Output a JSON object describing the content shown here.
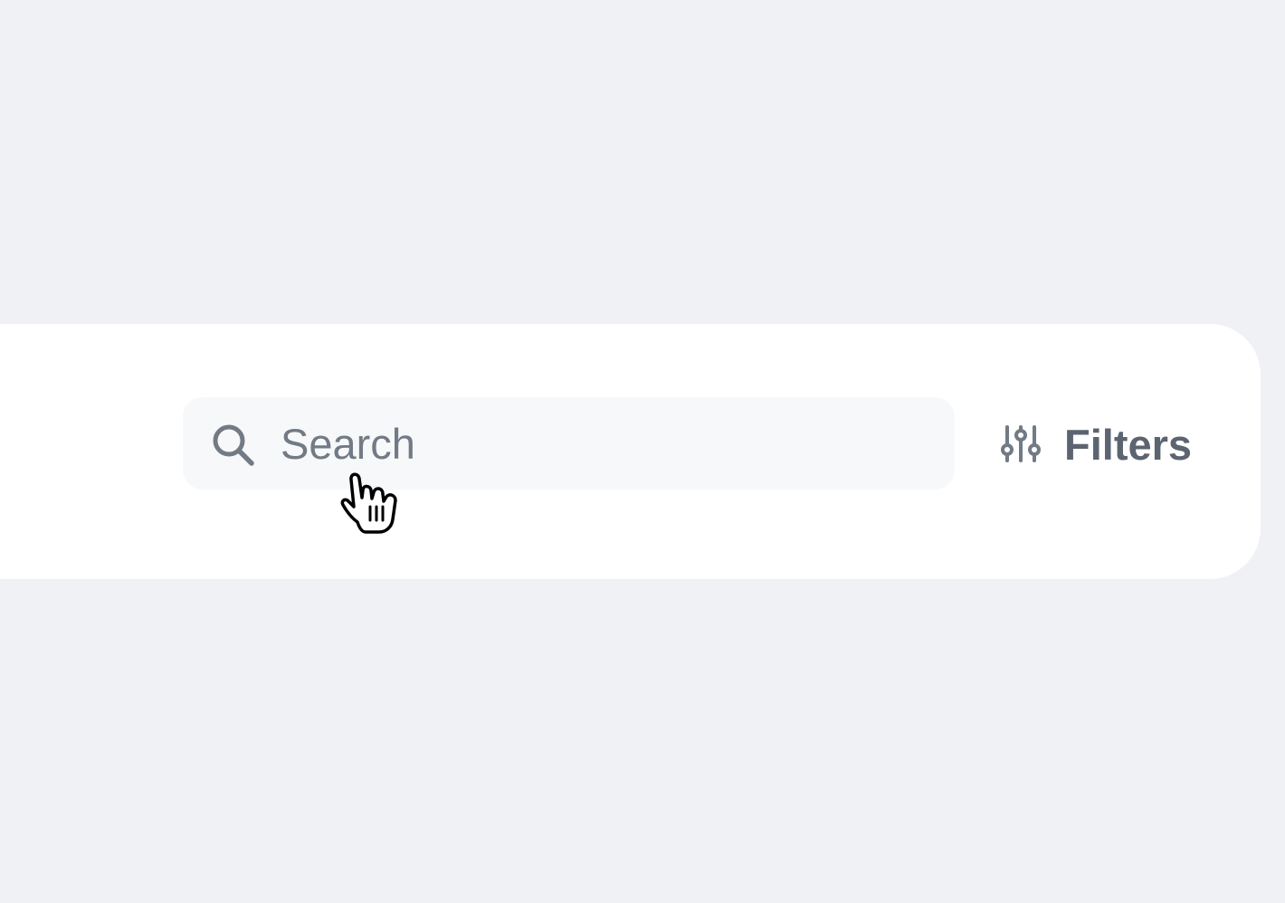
{
  "search": {
    "placeholder": "Search",
    "value": ""
  },
  "filters": {
    "label": "Filters"
  },
  "icons": {
    "search": "search-icon",
    "filters": "sliders-icon",
    "cursor": "hand-pointer-cursor-icon"
  },
  "colors": {
    "page_background": "#f0f1f5",
    "panel_background": "#ffffff",
    "input_background": "#f7f8fa",
    "icon_gray": "#727b85",
    "text_gray": "#5b6470"
  }
}
